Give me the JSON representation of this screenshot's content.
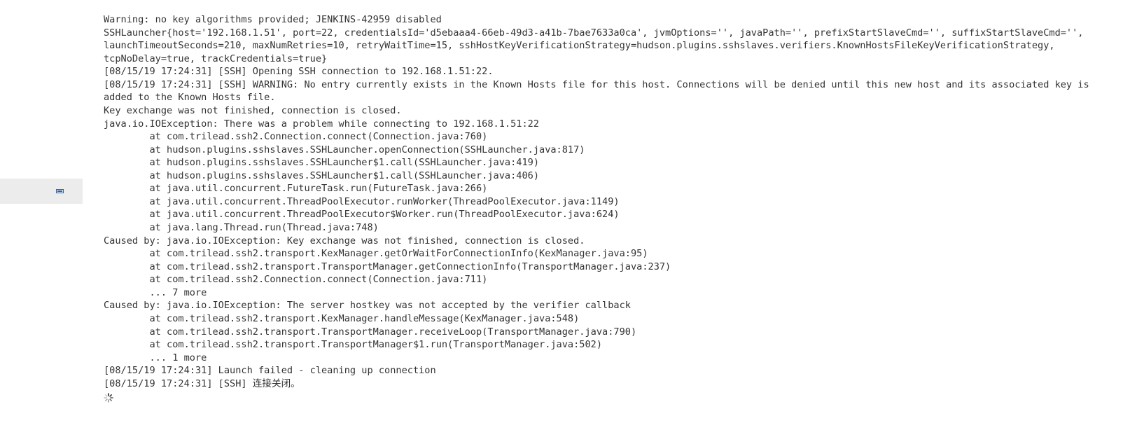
{
  "sidebar": {
    "collapsed_item_icon": "minimize-icon"
  },
  "console": {
    "lines": [
      "Warning: no key algorithms provided; JENKINS-42959 disabled",
      "SSHLauncher{host='192.168.1.51', port=22, credentialsId='d5ebaaa4-66eb-49d3-a41b-7bae7633a0ca', jvmOptions='', javaPath='', prefixStartSlaveCmd='', suffixStartSlaveCmd='',",
      "launchTimeoutSeconds=210, maxNumRetries=10, retryWaitTime=15, sshHostKeyVerificationStrategy=hudson.plugins.sshslaves.verifiers.KnownHostsFileKeyVerificationStrategy,",
      "tcpNoDelay=true, trackCredentials=true}",
      "[08/15/19 17:24:31] [SSH] Opening SSH connection to 192.168.1.51:22.",
      "[08/15/19 17:24:31] [SSH] WARNING: No entry currently exists in the Known Hosts file for this host. Connections will be denied until this new host and its associated key is",
      "added to the Known Hosts file.",
      "Key exchange was not finished, connection is closed.",
      "java.io.IOException: There was a problem while connecting to 192.168.1.51:22",
      "\tat com.trilead.ssh2.Connection.connect(Connection.java:760)",
      "\tat hudson.plugins.sshslaves.SSHLauncher.openConnection(SSHLauncher.java:817)",
      "\tat hudson.plugins.sshslaves.SSHLauncher$1.call(SSHLauncher.java:419)",
      "\tat hudson.plugins.sshslaves.SSHLauncher$1.call(SSHLauncher.java:406)",
      "\tat java.util.concurrent.FutureTask.run(FutureTask.java:266)",
      "\tat java.util.concurrent.ThreadPoolExecutor.runWorker(ThreadPoolExecutor.java:1149)",
      "\tat java.util.concurrent.ThreadPoolExecutor$Worker.run(ThreadPoolExecutor.java:624)",
      "\tat java.lang.Thread.run(Thread.java:748)",
      "Caused by: java.io.IOException: Key exchange was not finished, connection is closed.",
      "\tat com.trilead.ssh2.transport.KexManager.getOrWaitForConnectionInfo(KexManager.java:95)",
      "\tat com.trilead.ssh2.transport.TransportManager.getConnectionInfo(TransportManager.java:237)",
      "\tat com.trilead.ssh2.Connection.connect(Connection.java:711)",
      "\t... 7 more",
      "Caused by: java.io.IOException: The server hostkey was not accepted by the verifier callback",
      "\tat com.trilead.ssh2.transport.KexManager.handleMessage(KexManager.java:548)",
      "\tat com.trilead.ssh2.transport.TransportManager.receiveLoop(TransportManager.java:790)",
      "\tat com.trilead.ssh2.transport.TransportManager$1.run(TransportManager.java:502)",
      "\t... 1 more",
      "[08/15/19 17:24:31] Launch failed - cleaning up connection",
      "[08/15/19 17:24:31] [SSH] 连接关闭。"
    ],
    "spinner_icon": "loading-spinner-icon"
  }
}
